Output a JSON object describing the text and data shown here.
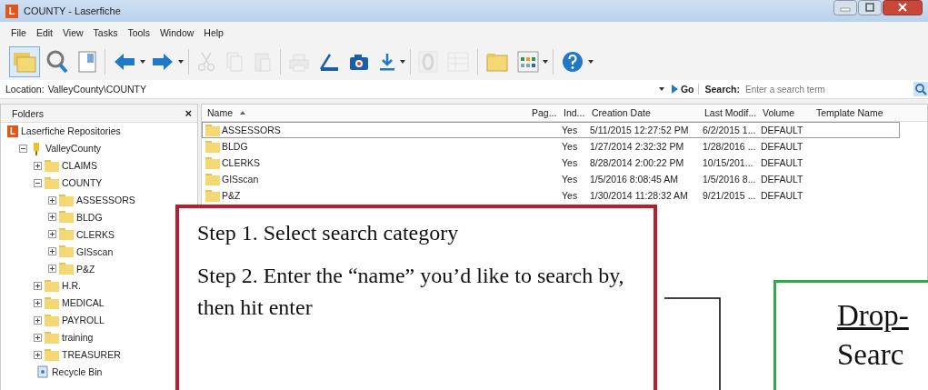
{
  "window": {
    "icon_letter": "L",
    "title": "COUNTY - Laserfiche"
  },
  "menu": [
    "File",
    "Edit",
    "View",
    "Tasks",
    "Tools",
    "Window",
    "Help"
  ],
  "toolbar": [
    {
      "kind": "folders",
      "disabled": false,
      "selected": true
    },
    {
      "kind": "search",
      "disabled": false,
      "selected": false
    },
    {
      "kind": "panel",
      "disabled": false,
      "selected": false
    },
    {
      "kind": "back",
      "disabled": false,
      "selected": false,
      "dropdown": true
    },
    {
      "kind": "forward",
      "disabled": false,
      "selected": false,
      "dropdown": true
    },
    {
      "kind": "cut",
      "disabled": true,
      "selected": false
    },
    {
      "kind": "copy",
      "disabled": true,
      "selected": false
    },
    {
      "kind": "paste",
      "disabled": true,
      "selected": false
    },
    {
      "kind": "print",
      "disabled": true,
      "selected": false
    },
    {
      "kind": "scanner",
      "disabled": false,
      "selected": false
    },
    {
      "kind": "camera",
      "disabled": false,
      "selected": false
    },
    {
      "kind": "download",
      "disabled": false,
      "selected": false,
      "dropdown": true
    },
    {
      "kind": "zero",
      "disabled": true,
      "selected": false
    },
    {
      "kind": "list",
      "disabled": true,
      "selected": false
    },
    {
      "kind": "newfolder",
      "disabled": false,
      "selected": false
    },
    {
      "kind": "grid",
      "disabled": false,
      "selected": false,
      "dropdown": true
    },
    {
      "kind": "help",
      "disabled": false,
      "selected": false,
      "dropdown": true
    }
  ],
  "location": {
    "label": "Location:",
    "value": "ValleyCounty\\COUNTY"
  },
  "search": {
    "go": "Go",
    "label": "Search:",
    "placeholder": "Enter a search term"
  },
  "folders_pane": {
    "title": "Folders",
    "close": "×",
    "tree": [
      {
        "label": "Laserfiche Repositories",
        "kind": "repository",
        "icon_letter": "L",
        "children": [
          {
            "label": "ValleyCounty",
            "kind": "cabinet",
            "expanded": true,
            "children": [
              {
                "label": "CLAIMS",
                "kind": "folder",
                "expanded": false
              },
              {
                "label": "COUNTY",
                "kind": "folder",
                "expanded": true,
                "children": [
                  {
                    "label": "ASSESSORS",
                    "kind": "folder",
                    "expanded": false
                  },
                  {
                    "label": "BLDG",
                    "kind": "folder",
                    "expanded": false
                  },
                  {
                    "label": "CLERKS",
                    "kind": "folder",
                    "expanded": false
                  },
                  {
                    "label": "GISscan",
                    "kind": "folder",
                    "expanded": false
                  },
                  {
                    "label": "P&Z",
                    "kind": "folder",
                    "expanded": false
                  }
                ]
              },
              {
                "label": "H.R.",
                "kind": "folder",
                "expanded": false
              },
              {
                "label": "MEDICAL",
                "kind": "folder",
                "expanded": false
              },
              {
                "label": "PAYROLL",
                "kind": "folder",
                "expanded": false
              },
              {
                "label": "training",
                "kind": "folder",
                "expanded": false
              },
              {
                "label": "TREASURER",
                "kind": "folder",
                "expanded": false
              },
              {
                "label": "Recycle Bin",
                "kind": "recycle"
              }
            ]
          }
        ]
      }
    ]
  },
  "table": {
    "columns": [
      "Name",
      "Pag...",
      "Ind...",
      "Creation Date",
      "Last Modif...",
      "Volume",
      "Template Name"
    ],
    "rows": [
      {
        "name": "ASSESSORS",
        "indexed": "Yes",
        "created": "5/11/2015 12:27:52 PM",
        "modified": "6/2/2015 1...",
        "volume": "DEFAULT",
        "selected": true
      },
      {
        "name": "BLDG",
        "indexed": "Yes",
        "created": "1/27/2014 2:32:32 PM",
        "modified": "1/28/2016 ...",
        "volume": "DEFAULT",
        "selected": false
      },
      {
        "name": "CLERKS",
        "indexed": "Yes",
        "created": "8/28/2014 2:00:22 PM",
        "modified": "10/15/201...",
        "volume": "DEFAULT",
        "selected": false
      },
      {
        "name": "GISscan",
        "indexed": "Yes",
        "created": "1/5/2016 8:08:45 AM",
        "modified": "1/5/2016 8...",
        "volume": "DEFAULT",
        "selected": false
      },
      {
        "name": "P&Z",
        "indexed": "Yes",
        "created": "1/30/2014 11:28:32 AM",
        "modified": "9/21/2015 ...",
        "volume": "DEFAULT",
        "selected": false
      }
    ]
  },
  "annotations": [
    {
      "kind": "steps",
      "lines": [
        "Step 1.  Select search category",
        "Step 2.  Enter the “name” you’d like to search by, then hit enter"
      ]
    },
    {
      "kind": "callout",
      "title": "Drop-",
      "text": "Searc"
    }
  ]
}
